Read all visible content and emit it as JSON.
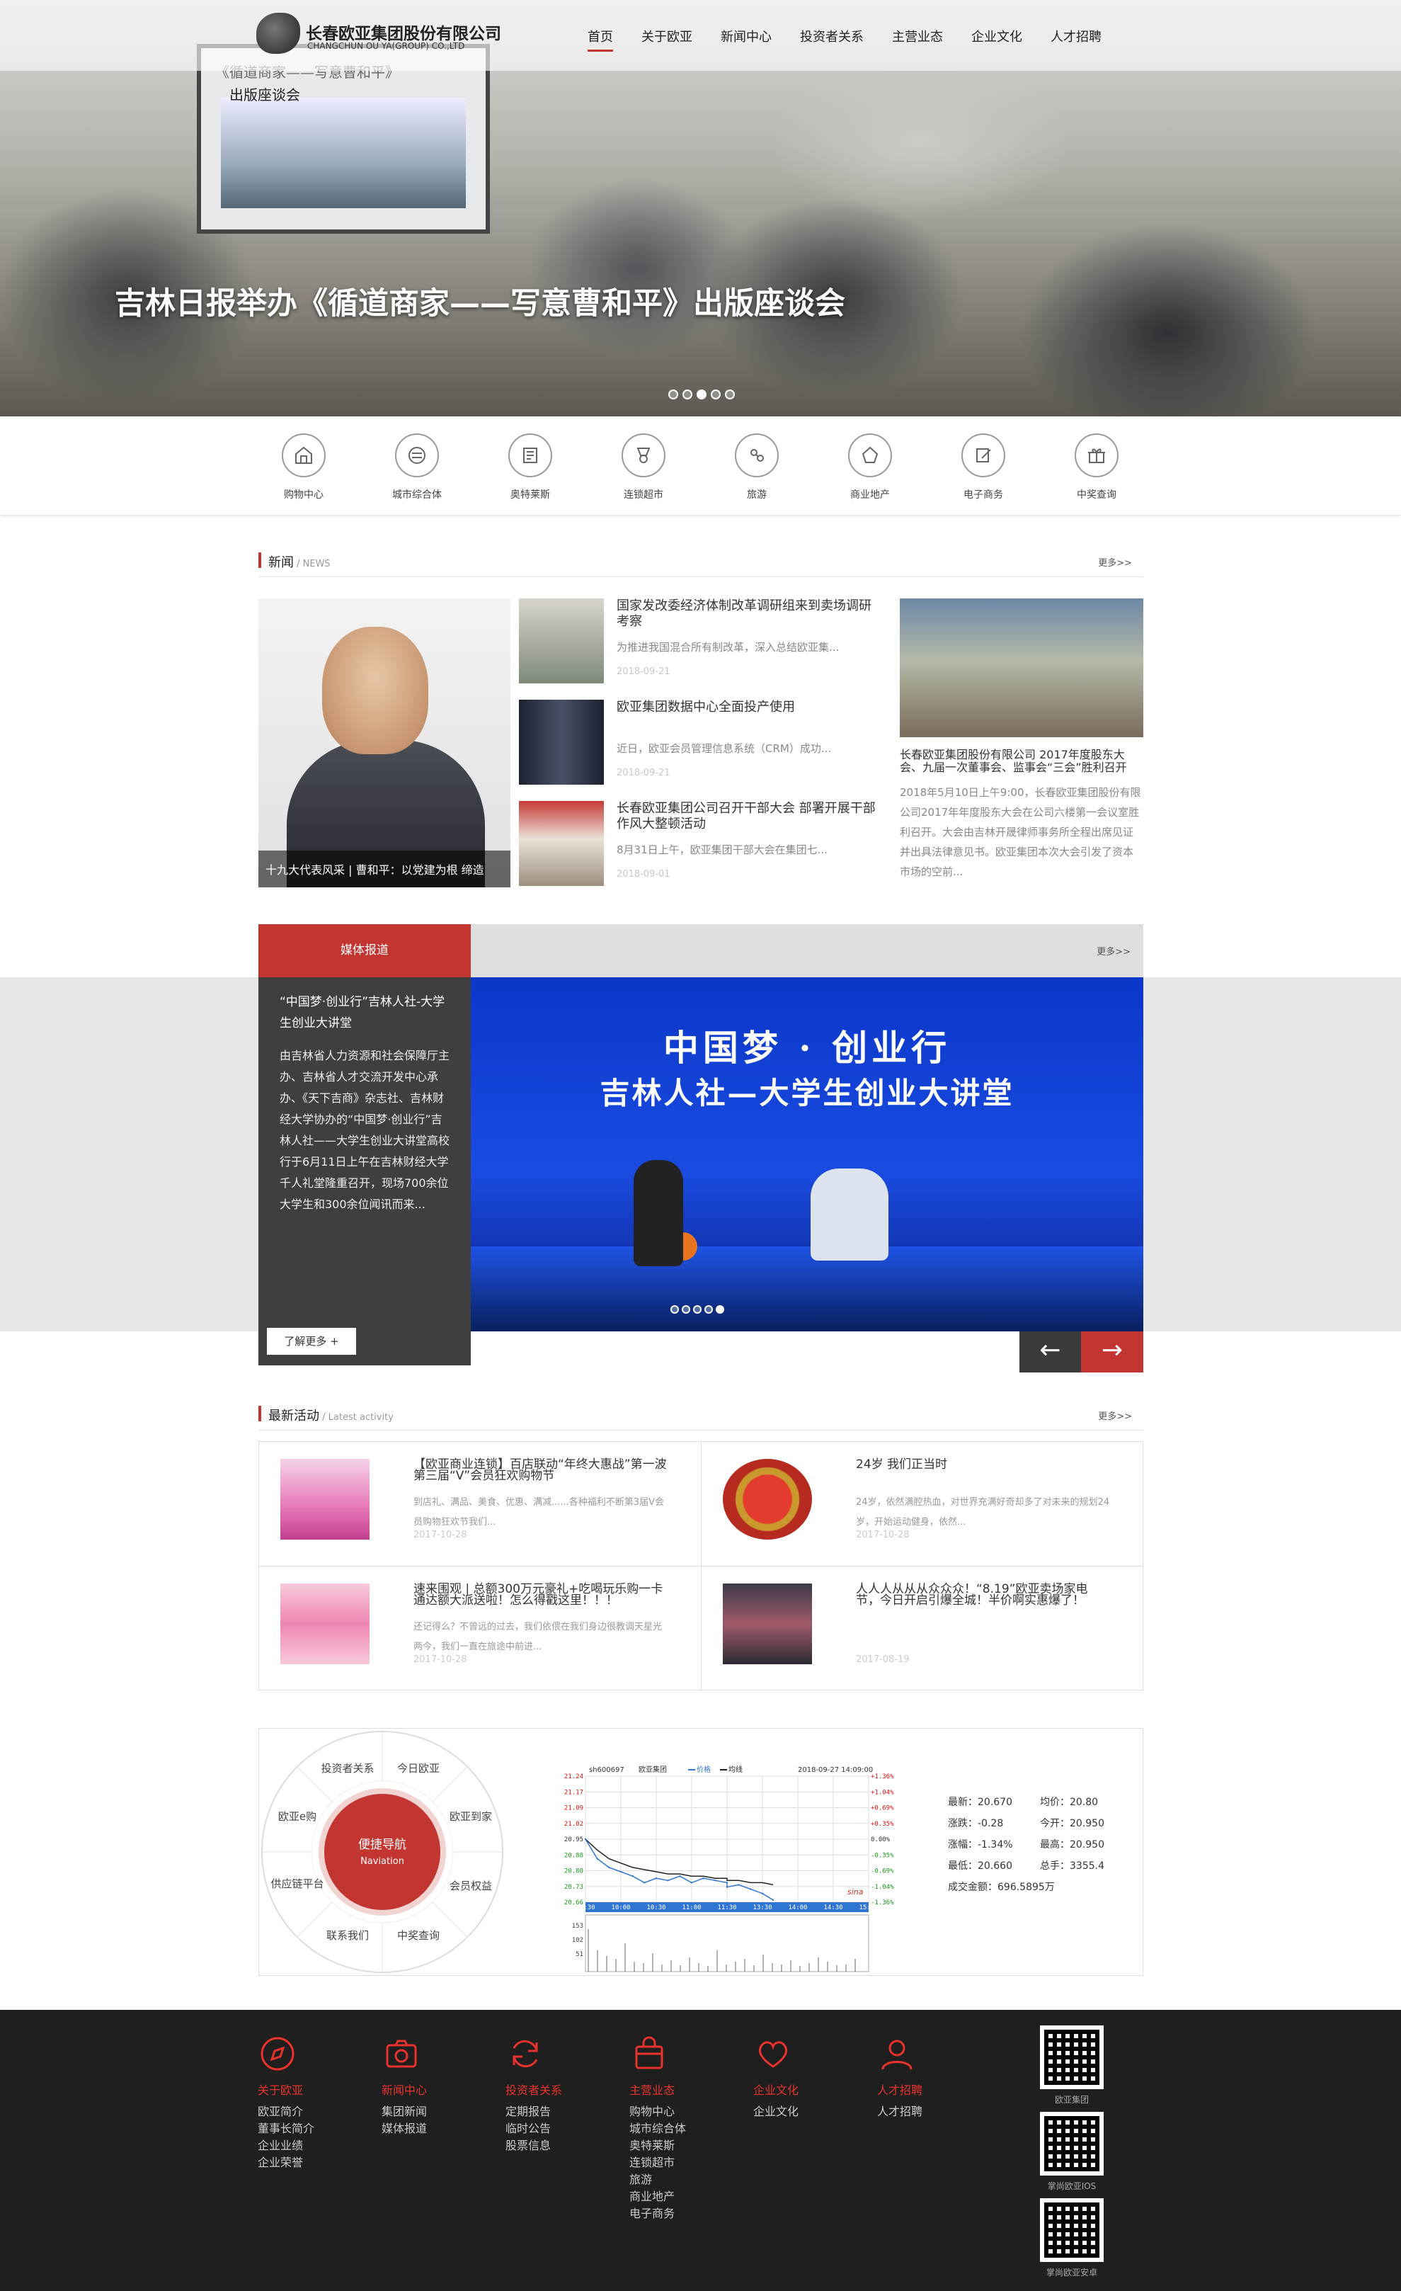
{
  "header": {
    "company_cn": "长春欧亚集团股份有限公司",
    "company_en": "CHANGCHUN OU YA(GROUP) CO.,LTD",
    "nav": [
      "首页",
      "关于欧亚",
      "新闻中心",
      "投资者关系",
      "主营业态",
      "企业文化",
      "人才招聘"
    ],
    "active_nav": "首页"
  },
  "hero": {
    "caption": "吉林日报举办《循道商家——写意曹和平》出版座谈会",
    "screen_line1": "《循道商家——写意曹和平》",
    "screen_line2": "出版座谈会",
    "dots": 5,
    "active_dot": 3
  },
  "quick_links": [
    {
      "label": "购物中心",
      "icon": "shop-icon"
    },
    {
      "label": "城市综合体",
      "icon": "city-complex-icon"
    },
    {
      "label": "奥特莱斯",
      "icon": "outlets-icon"
    },
    {
      "label": "连锁超市",
      "icon": "supermarket-icon"
    },
    {
      "label": "旅游",
      "icon": "travel-icon"
    },
    {
      "label": "商业地产",
      "icon": "real-estate-icon"
    },
    {
      "label": "电子商务",
      "icon": "ecommerce-icon"
    },
    {
      "label": "中奖查询",
      "icon": "gift-icon"
    }
  ],
  "news": {
    "title": "新闻",
    "subtitle": " / NEWS",
    "more": "更多>>",
    "featured_caption": "十九大代表风采 | 曹和平：以党建为根 缔造",
    "items": [
      {
        "title": "国家发改委经济体制改革调研组来到卖场调研考察",
        "desc": "为推进我国混合所有制改革，深入总结欧亚集...",
        "date": "2018-09-21"
      },
      {
        "title": "欧亚集团数据中心全面投产使用",
        "desc": "近日，欧亚会员管理信息系统（CRM）成功...",
        "date": "2018-09-21"
      },
      {
        "title": "长春欧亚集团公司召开干部大会 部署开展干部作风大整顿活动",
        "desc": "8月31日上午，欧亚集团干部大会在集团七...",
        "date": "2018-09-01"
      }
    ],
    "right": {
      "title": "长春欧亚集团股份有限公司 2017年度股东大会、九届一次董事会、监事会“三会”胜利召开",
      "desc": "2018年5月10日上午9:00，长春欧亚集团股份有限公司2017年年度股东大会在公司六楼第一会议室胜利召开。大会由吉林开晟律师事务所全程出席见证并出具法律意见书。欧亚集团本次大会引发了资本市场的空前..."
    }
  },
  "media": {
    "tab": "媒体报道",
    "more": "更多>>",
    "title": "“中国梦·创业行”吉林人社-大学生创业大讲堂",
    "desc": "由吉林省人力资源和社会保障厅主办、吉林省人才交流开发中心承办、《天下吉商》杂志社、吉林财经大学协办的“中国梦·创业行”吉林人社——大学生创业大讲堂高校行于6月11日上午在吉林财经大学千人礼堂隆重召开，现场700余位大学生和300余位闻讯而来...",
    "button": "了解更多 +",
    "banner_line1": "中国梦 · 创业行",
    "banner_line2": "吉林人社—大学生创业大讲堂",
    "dots": 5,
    "active_dot": 5,
    "prev": "←",
    "next": "→"
  },
  "activities": {
    "title": "最新活动",
    "subtitle": " / Latest activity",
    "more": "更多>>",
    "items": [
      {
        "title": "【欧亚商业连锁】百店联动“年终大惠战”第一波 第三届“V”会员狂欢购物节",
        "desc": "到店礼、满品、美食、优惠、满减......各种福利不断第3届V会员购物狂欢节我们...",
        "date": "2017-10-28"
      },
      {
        "title": "24岁 我们正当时",
        "desc": "24岁，依然满腔热血，对世界充满好奇却多了对未来的规划24岁，开始运动健身，依然...",
        "date": "2017-10-28"
      },
      {
        "title": "速来围观 | 总额300万元豪礼+吃喝玩乐购一卡通达额大派送啦！怎么得戳这里！！！",
        "desc": "还记得么？不曾远的过去，我们依偎在我们身边很教调天星光两今，我们一直在旅途中前进...",
        "date": "2017-10-28"
      },
      {
        "title": "人人人从从从众众众！“8.19”欧亚卖场家电节，今日开启引爆全城！半价啊实惠爆了！",
        "desc": "",
        "date": "2017-08-19"
      }
    ]
  },
  "quick_nav": {
    "center": "便捷导航",
    "center_en": "Naviation",
    "items": [
      "投资者关系",
      "今日欧亚",
      "欧亚到家",
      "会员权益",
      "中奖查询",
      "联系我们",
      "供应链平台",
      "欧亚e购"
    ]
  },
  "stock": {
    "code": "sh600697",
    "name": "欧亚集团",
    "legend_price": "价格",
    "legend_avg": "均线",
    "timestamp": "2018-09-27 14:09:00",
    "y_left": [
      "21.24",
      "21.17",
      "21.09",
      "21.02",
      "20.95",
      "20.88",
      "20.80",
      "20.73",
      "20.66"
    ],
    "y_right": [
      "+1.36%",
      "+1.04%",
      "+0.69%",
      "+0.35%",
      "0.00%",
      "-0.35%",
      "-0.69%",
      "-1.04%",
      "-1.36%"
    ],
    "x_labels": [
      "09:30",
      "10:00",
      "10:30",
      "11:00",
      "11:30",
      "13:30",
      "14:00",
      "14:30",
      "15:00"
    ],
    "vol_labels": [
      "153",
      "102",
      "51"
    ],
    "brand": "sina",
    "chart_data": {
      "type": "line",
      "title": "",
      "xlabel": "",
      "ylabel": "",
      "ylim": [
        20.66,
        21.24
      ],
      "x": [
        "09:30",
        "09:40",
        "09:50",
        "10:00",
        "10:10",
        "10:20",
        "10:30",
        "10:40",
        "10:50",
        "11:00",
        "11:10",
        "11:20",
        "11:30",
        "13:30",
        "13:40",
        "13:50",
        "14:00",
        "14:09"
      ],
      "series": [
        {
          "name": "价格",
          "values": [
            20.95,
            20.86,
            20.82,
            20.8,
            20.78,
            20.75,
            20.77,
            20.76,
            20.78,
            20.75,
            20.77,
            20.76,
            20.75,
            20.73,
            20.74,
            20.72,
            20.7,
            20.67
          ]
        },
        {
          "name": "均线",
          "values": [
            20.95,
            20.9,
            20.86,
            20.84,
            20.82,
            20.81,
            20.8,
            20.79,
            20.79,
            20.78,
            20.78,
            20.77,
            20.77,
            20.76,
            20.76,
            20.75,
            20.75,
            20.74
          ]
        }
      ]
    },
    "info": [
      [
        "最新：20.670",
        "均价：20.80"
      ],
      [
        "涨跌：-0.28",
        "今开：20.950"
      ],
      [
        "涨幅：-1.34%",
        "最高：20.950"
      ],
      [
        "最低：20.660",
        "总手：3355.4"
      ],
      [
        "成交金额：696.5895万",
        ""
      ]
    ]
  },
  "footer": {
    "columns": [
      {
        "title": "关于欧亚",
        "icon": "compass-icon",
        "links": [
          "欧亚简介",
          "董事长简介",
          "企业业绩",
          "企业荣誉"
        ]
      },
      {
        "title": "新闻中心",
        "icon": "camera-icon",
        "links": [
          "集团新闻",
          "媒体报道"
        ]
      },
      {
        "title": "投资者关系",
        "icon": "refresh-icon",
        "links": [
          "定期报告",
          "临时公告",
          "股票信息"
        ]
      },
      {
        "title": "主营业态",
        "icon": "shopping-bag-icon",
        "links": [
          "购物中心",
          "城市综合体",
          "奥特莱斯",
          "连锁超市",
          "旅游",
          "商业地产",
          "电子商务"
        ]
      },
      {
        "title": "企业文化",
        "icon": "heart-icon",
        "links": [
          "企业文化"
        ]
      },
      {
        "title": "人才招聘",
        "icon": "user-icon",
        "links": [
          "人才招聘"
        ]
      }
    ],
    "qr_labels": [
      "欧亚集团",
      "掌尚欧亚IOS",
      "掌尚欧亚安卓"
    ],
    "accent": "#e8322e"
  },
  "colors": {
    "brand_red": "#c23531",
    "dark": "#3f3f3f",
    "footer_bg": "#1f1f1f"
  }
}
